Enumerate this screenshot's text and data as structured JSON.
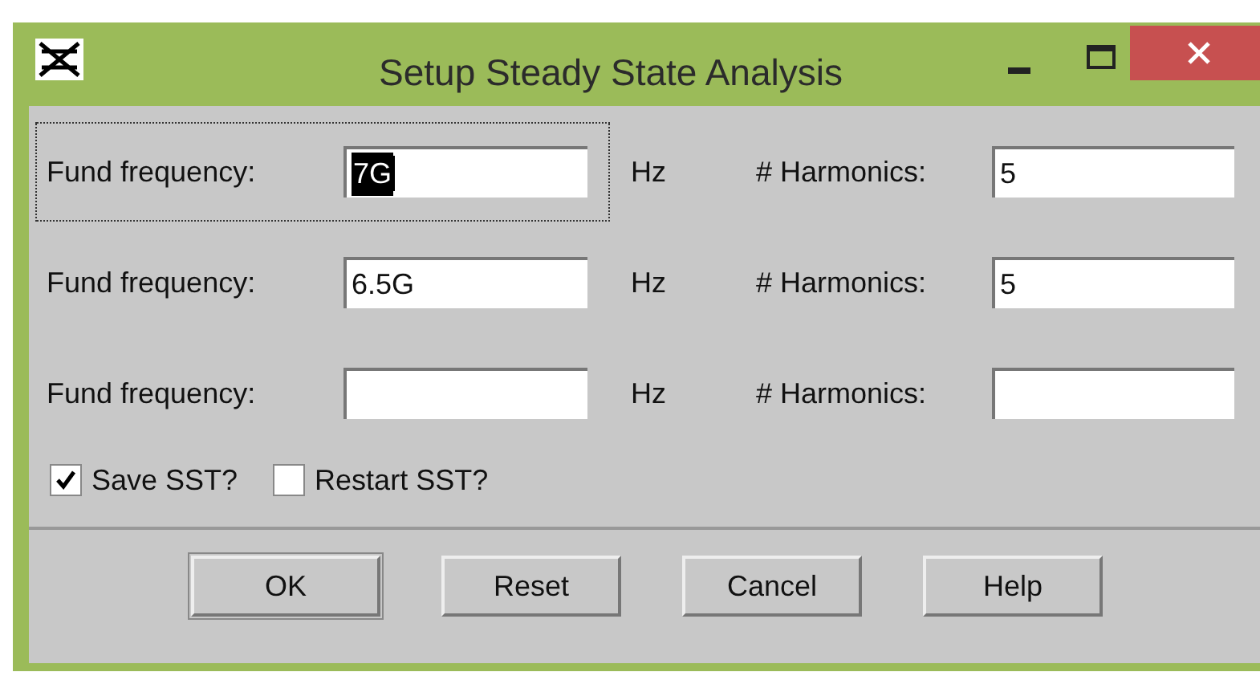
{
  "window": {
    "title": "Setup Steady State Analysis"
  },
  "rows": [
    {
      "freq_label": "Fund frequency:",
      "freq_value": "7G",
      "focused": true,
      "unit": "Hz",
      "harm_label": "# Harmonics:",
      "harm_value": "5"
    },
    {
      "freq_label": "Fund frequency:",
      "freq_value": "6.5G",
      "focused": false,
      "unit": "Hz",
      "harm_label": "# Harmonics:",
      "harm_value": "5"
    },
    {
      "freq_label": "Fund frequency:",
      "freq_value": "",
      "focused": false,
      "unit": "Hz",
      "harm_label": "# Harmonics:",
      "harm_value": ""
    }
  ],
  "options": [
    {
      "label": "Save SST?",
      "checked": true
    },
    {
      "label": "Restart SST?",
      "checked": false
    }
  ],
  "buttons": [
    {
      "label": "OK",
      "default": true
    },
    {
      "label": "Reset",
      "default": false
    },
    {
      "label": "Cancel",
      "default": false
    },
    {
      "label": "Help",
      "default": false
    }
  ]
}
